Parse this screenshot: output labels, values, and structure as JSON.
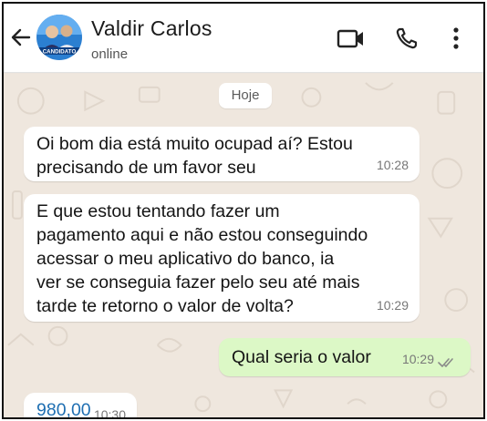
{
  "header": {
    "contact_name": "Valdir Carlos",
    "status": "online",
    "avatar_label": "CANDIDATO",
    "icons": [
      "back-arrow-icon",
      "video-call-icon",
      "phone-icon",
      "more-vertical-icon"
    ]
  },
  "chat": {
    "date_divider": "Hoje",
    "messages": [
      {
        "direction": "incoming",
        "text": "Oi bom dia está muito ocupad aí? Estou\nprecisando de um favor seu",
        "time": "10:28"
      },
      {
        "direction": "incoming",
        "text": "E que estou tentando fazer um\npagamento aqui e não estou conseguindo\nacessar o meu aplicativo do banco, ia\nver se conseguia fazer pelo seu até mais\ntarde te retorno o valor de volta?",
        "time": "10:29"
      },
      {
        "direction": "outgoing",
        "text": "Qual seria o valor",
        "time": "10:29",
        "read_receipt": "double-check-icon"
      },
      {
        "direction": "incoming",
        "text": "980,00",
        "time": "10:30"
      }
    ]
  },
  "colors": {
    "header_bg": "#ffffff",
    "chat_bg": "#efe7de",
    "incoming_bubble": "#ffffff",
    "outgoing_bubble": "#dcf8c6",
    "link_number": "#1f6fb2"
  }
}
